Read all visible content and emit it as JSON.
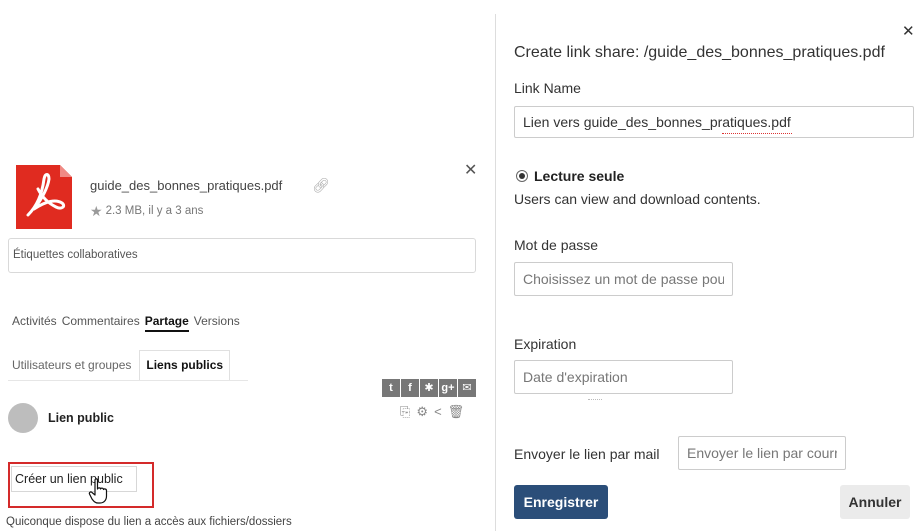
{
  "sidebar": {
    "file": {
      "name": "guide_des_bonnes_pratiques.pdf",
      "meta": "2.3 MB, il y a 3 ans",
      "icon": "pdf-icon",
      "icon_color": "#e02b20"
    },
    "tags_placeholder": "Étiquettes collaboratives",
    "tabs": [
      {
        "label": "Activités"
      },
      {
        "label": "Commentaires"
      },
      {
        "label": "Partage",
        "active": true
      },
      {
        "label": "Versions"
      }
    ],
    "share_tabs": [
      {
        "label": "Utilisateurs et groupes"
      },
      {
        "label": "Liens publics",
        "active": true
      }
    ],
    "social_icons": [
      "twitter-icon",
      "facebook-icon",
      "diaspora-icon",
      "googleplus-icon",
      "email-icon"
    ],
    "public_link": {
      "label": "Lien public",
      "actions": [
        "copy-icon",
        "gear-icon",
        "share-icon",
        "trash-icon"
      ]
    },
    "create_button": "Créer un lien public",
    "help_text": "Quiconque dispose du lien a accès aux fichiers/dossiers",
    "highlight_color": "#d42a2a"
  },
  "dialog": {
    "title": "Create link share: /guide_des_bonnes_pratiques.pdf",
    "link_name_label": "Link Name",
    "link_name_value": "Lien vers guide_des_bonnes_pratiques.pdf",
    "permission_label": "Lecture seule",
    "permission_desc": "Users can view and download contents.",
    "password_label": "Mot de passe",
    "password_placeholder": "Choisissez un mot de passe pour le lien",
    "expiration_label": "Expiration",
    "expiration_placeholder": "Date d'expiration",
    "email_label": "Envoyer le lien par mail",
    "email_placeholder": "Envoyer le lien par courriel",
    "save_button": "Enregistrer",
    "cancel_button": "Annuler",
    "save_color": "#2b4e79"
  }
}
